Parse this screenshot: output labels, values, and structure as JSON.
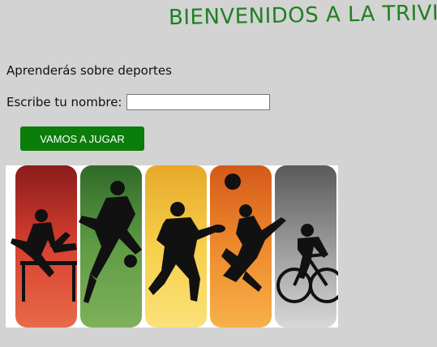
{
  "header": {
    "title": "BIENVENIDOS A LA TRIVIA"
  },
  "main": {
    "intro_text": "Aprenderás sobre deportes",
    "name_label": "Escribe tu nombre:",
    "name_value": "",
    "play_button_label": "VAMOS A JUGAR"
  },
  "banner": {
    "icon": "sports-silhouettes-image",
    "panels": [
      {
        "sport": "hurdles",
        "color": "#c8352d"
      },
      {
        "sport": "soccer",
        "color": "#4f8c3a"
      },
      {
        "sport": "football",
        "color": "#f0c040"
      },
      {
        "sport": "basketball",
        "color": "#e8802a"
      },
      {
        "sport": "cycling",
        "color": "#8a8a8a"
      }
    ]
  },
  "colors": {
    "background": "#d3d3d3",
    "title": "#208020",
    "button": "#0a7d0a"
  }
}
